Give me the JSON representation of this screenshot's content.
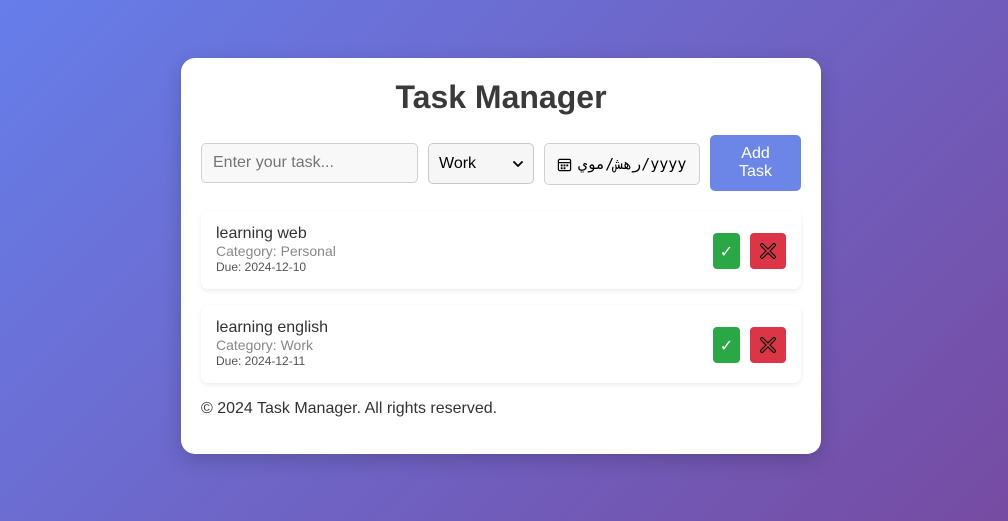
{
  "header": {
    "title": "Task Manager"
  },
  "form": {
    "task_placeholder": "Enter your task...",
    "category_selected": "Work",
    "date_placeholder": "رهش/موي/yyyy",
    "add_label_line1": "Add",
    "add_label_line2": "Task"
  },
  "tasks": [
    {
      "name": "learning web",
      "category": "Category: Personal",
      "due": "Due: 2024-12-10"
    },
    {
      "name": "learning english",
      "category": "Category: Work",
      "due": "Due: 2024-12-11"
    }
  ],
  "actions": {
    "done_icon": "check-icon",
    "delete_icon": "cross-icon",
    "done_glyph": "✓"
  },
  "footer": {
    "text": "© 2024 Task Manager. All rights reserved."
  },
  "colors": {
    "gradient_start": "#667eea",
    "gradient_end": "#764ba2",
    "add_button": "#6b86e7",
    "done_button": "#2aa845",
    "delete_button": "#dc3545"
  }
}
